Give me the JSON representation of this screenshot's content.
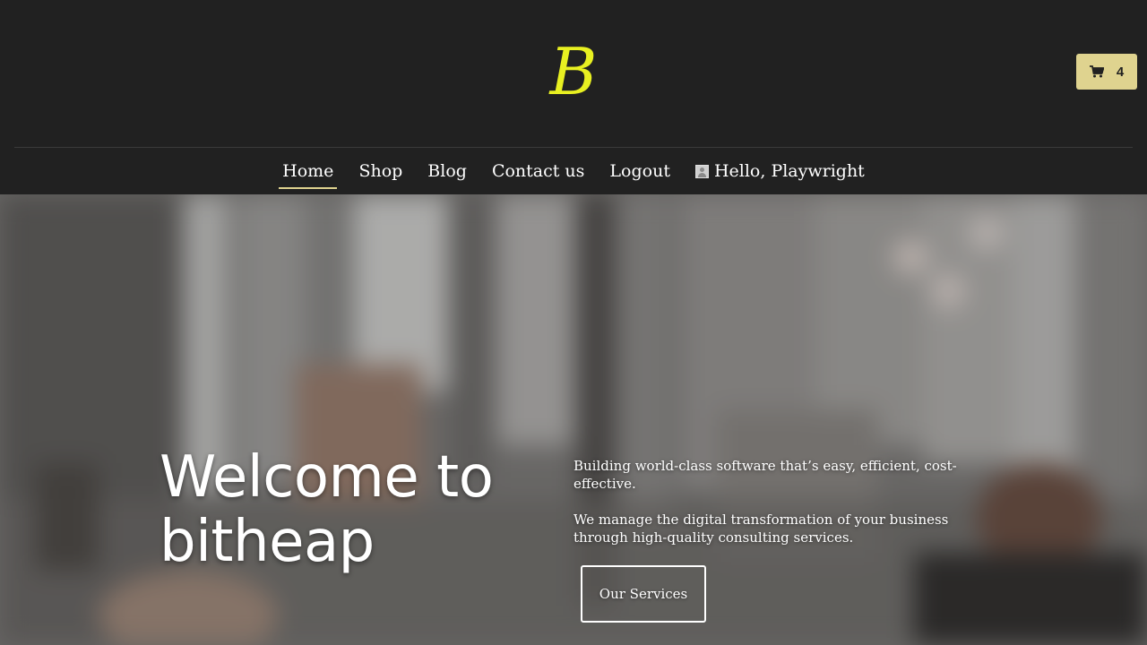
{
  "header": {
    "logo_letter": "B",
    "logo_color": "#e8f021",
    "cart": {
      "icon": "cart-icon",
      "count": "4",
      "color": "#dfd38f"
    }
  },
  "nav": {
    "items": [
      {
        "label": "Home",
        "active": true
      },
      {
        "label": "Shop"
      },
      {
        "label": "Blog"
      },
      {
        "label": "Contact us"
      },
      {
        "label": "Logout"
      }
    ],
    "user": {
      "avatar": "avatar-icon",
      "greeting": "Hello, Playwright"
    },
    "active_underline_color": "#dfd38f"
  },
  "hero": {
    "title": "Welcome to bitheap",
    "paragraphs": [
      "Building world-class software that’s easy, efficient, cost-effective.",
      "We manage the digital transformation of your business through high-quality consulting services."
    ],
    "button_label": "Our Services"
  }
}
